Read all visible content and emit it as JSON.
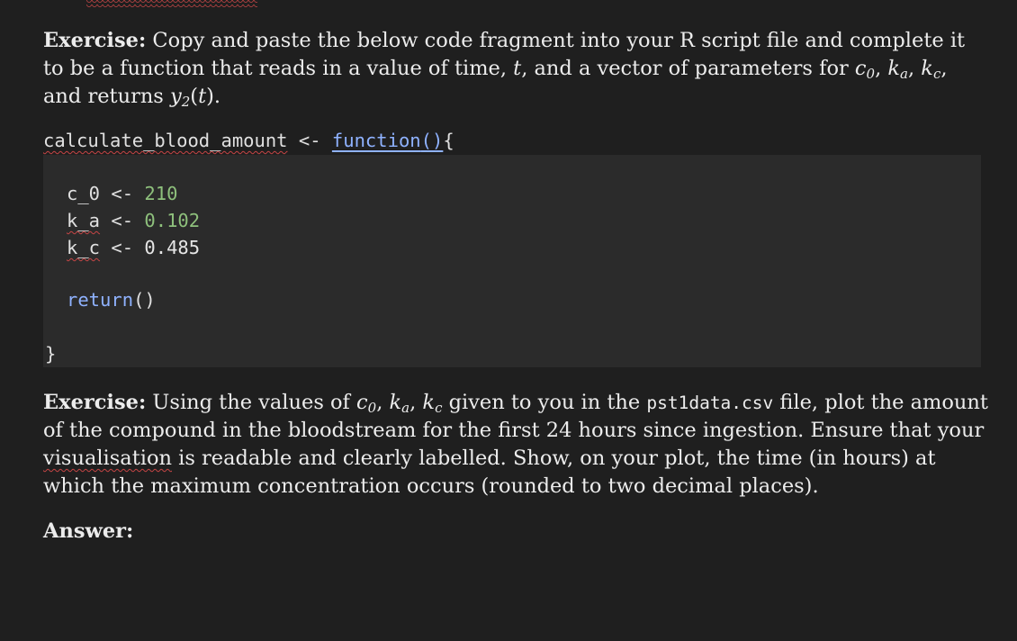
{
  "exercise1": {
    "label": "Exercise:",
    "text_a": " Copy and paste the below code fragment into your R script file and complete it to be a function that reads in a value of time, ",
    "t": "t",
    "text_b": ", and a vector of parameters for ",
    "c": "c",
    "c_sub": "0",
    "sep1": ", ",
    "k": "k",
    "ka_sub": "a",
    "sep2": ", ",
    "kc_sub": "c",
    "text_c": ", and returns ",
    "y": "y",
    "y_sub": "2",
    "text_d": "(",
    "text_e": ").",
    "t2": "t"
  },
  "code": {
    "fn_name": "calculate_blood_amount",
    "assign": " <- ",
    "keyword": "function",
    "paren": "()",
    "brace_open": "{",
    "lines": [
      {
        "var": "c_0",
        "op": " <- ",
        "val": "210"
      },
      {
        "var": "k_a",
        "op": " <- ",
        "val": "0.102"
      },
      {
        "var": "k_c",
        "op": " <- ",
        "val": "0.485"
      }
    ],
    "return_kw": "return",
    "return_paren": "()",
    "brace_close": "}"
  },
  "exercise2": {
    "label": "Exercise:",
    "text_a": " Using the values of ",
    "c": "c",
    "c_sub": "0",
    "sep1": ", ",
    "k": "k",
    "ka_sub": "a",
    "sep2": ", ",
    "kc_sub": "c",
    "text_b": " given to you in the ",
    "filename": "pst1data.csv",
    "text_c": " file, plot the amount of the compound in the bloodstream for the first 24 hours since ingestion. Ensure that your ",
    "squiggle_word": "visualisation",
    "text_d": " is readable and clearly labelled. Show, on your plot, the time (in hours) at which the maximum concentration occurs (rounded to two decimal places)."
  },
  "answer_label": "Answer:"
}
